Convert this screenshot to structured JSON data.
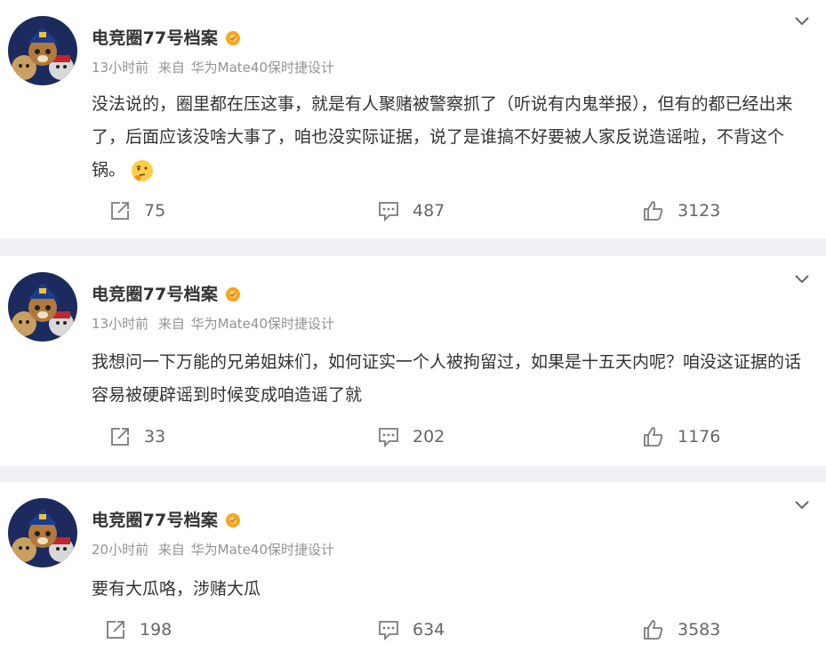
{
  "posts": [
    {
      "author": "电竞圈77号档案",
      "time": "13小时前",
      "source_prefix": "来自",
      "device": "华为Mate40保时捷设计",
      "text": "没法说的，圈里都在压这事，就是有人聚赌被警察抓了（听说有内鬼举报），但有的都已经出来了，后面应该没啥大事了，咱也没实际证据，说了是谁搞不好要被人家反说造谣啦，不背这个锅。",
      "emoji": "thinking-emoji",
      "reposts": "75",
      "comments": "487",
      "likes": "3123"
    },
    {
      "author": "电竞圈77号档案",
      "time": "13小时前",
      "source_prefix": "来自",
      "device": "华为Mate40保时捷设计",
      "text": "我想问一下万能的兄弟姐妹们，如何证实一个人被拘留过，如果是十五天内呢？咱没这证据的话容易被硬辟谣到时候变成咱造谣了就",
      "reposts": "33",
      "comments": "202",
      "likes": "1176"
    },
    {
      "author": "电竞圈77号档案",
      "time": "20小时前",
      "source_prefix": "来自",
      "device": "华为Mate40保时捷设计",
      "text": "要有大瓜咯，涉赌大瓜",
      "reposts": "198",
      "comments": "634",
      "likes": "3583"
    }
  ],
  "colors": {
    "separator": "#f0f1f4",
    "meta_text": "#939393",
    "vip_badge": "#f5a623",
    "icon": "#7a7a7a"
  }
}
